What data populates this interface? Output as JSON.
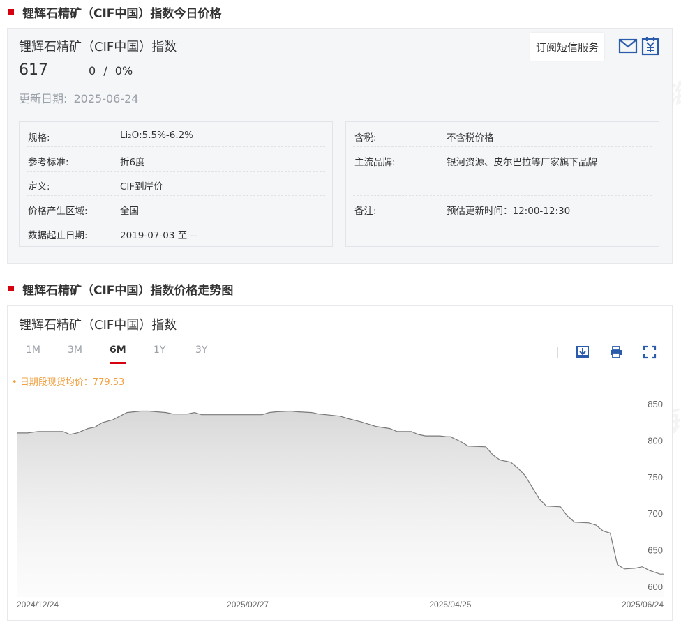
{
  "section1": {
    "title": "锂辉石精矿（CIF中国）指数今日价格"
  },
  "card1": {
    "name": "锂辉石精矿（CIF中国）指数",
    "price": "617",
    "change": "0",
    "separator": "/",
    "change_pct": "0%",
    "date_label": "更新日期:",
    "date_value": "2025-06-24",
    "sms_label": "订阅短信服务"
  },
  "spec_left": [
    {
      "k": "规格:",
      "v": "Li₂O:5.5%-6.2%"
    },
    {
      "k": "参考标准:",
      "v": "折6度"
    },
    {
      "k": "定义:",
      "v": "CIF到岸价"
    },
    {
      "k": "价格产生区域:",
      "v": "全国"
    },
    {
      "k": "数据起止日期:",
      "v": "2019-07-03 至 --"
    }
  ],
  "spec_right": [
    {
      "k": "含税:",
      "v": "不含税价格"
    },
    {
      "k": "主流品牌:",
      "v": "银河资源、皮尔巴拉等厂家旗下品牌"
    },
    {
      "k": "备注:",
      "v": "预估更新时间：12:00-12:30"
    }
  ],
  "section2": {
    "title": "锂辉石精矿（CIF中国）指数价格走势图"
  },
  "card2": {
    "name": "锂辉石精矿（CIF中国）指数",
    "tabs": [
      "1M",
      "3M",
      "6M",
      "1Y",
      "3Y"
    ],
    "active_tab": "6M",
    "avg_label": "• 日期段现货均价：779.53"
  },
  "watermark": {
    "text": "SMM 上海有色网"
  },
  "icons": {
    "mail": "mail-icon",
    "yuan": "yuan-calendar-icon",
    "download": "download-icon",
    "print": "print-icon",
    "fullscreen": "fullscreen-icon"
  },
  "colors": {
    "accent": "#d6000f",
    "icon_blue": "#2b5cab",
    "avg": "#f0a040",
    "line": "#7a7a7a"
  },
  "chart_data": {
    "type": "area",
    "title": "",
    "xlabel": "",
    "ylabel": "",
    "ylim": [
      600,
      870
    ],
    "yticks": [
      600,
      650,
      700,
      750,
      800,
      850
    ],
    "xticks": [
      {
        "label": "2024/12/24",
        "x": "2024-12-24"
      },
      {
        "label": "2025/02/27",
        "x": "2025-02-27"
      },
      {
        "label": "2025/04/25",
        "x": "2025-04-25"
      },
      {
        "label": "2025/06/24",
        "x": "2025-06-24"
      }
    ],
    "x_range": [
      "2024-12-24",
      "2025-06-24"
    ],
    "grid": false,
    "series": [
      {
        "points": [
          [
            "2024-12-24",
            810
          ],
          [
            "2024-12-27",
            810
          ],
          [
            "2024-12-30",
            812
          ],
          [
            "2025-01-02",
            812
          ],
          [
            "2025-01-06",
            812
          ],
          [
            "2025-01-08",
            808
          ],
          [
            "2025-01-10",
            810
          ],
          [
            "2025-01-13",
            816
          ],
          [
            "2025-01-15",
            818
          ],
          [
            "2025-01-17",
            824
          ],
          [
            "2025-01-20",
            828
          ],
          [
            "2025-01-22",
            833
          ],
          [
            "2025-01-24",
            838
          ],
          [
            "2025-01-28",
            840
          ],
          [
            "2025-01-30",
            840
          ],
          [
            "2025-02-04",
            838
          ],
          [
            "2025-02-06",
            836
          ],
          [
            "2025-02-10",
            836
          ],
          [
            "2025-02-12",
            838
          ],
          [
            "2025-02-14",
            835
          ],
          [
            "2025-02-18",
            835
          ],
          [
            "2025-02-21",
            835
          ],
          [
            "2025-02-25",
            835
          ],
          [
            "2025-02-27",
            835
          ],
          [
            "2025-03-03",
            835
          ],
          [
            "2025-03-05",
            838
          ],
          [
            "2025-03-07",
            839
          ],
          [
            "2025-03-11",
            840
          ],
          [
            "2025-03-13",
            839
          ],
          [
            "2025-03-17",
            838
          ],
          [
            "2025-03-19",
            836
          ],
          [
            "2025-03-21",
            835
          ],
          [
            "2025-03-25",
            833
          ],
          [
            "2025-03-27",
            830
          ],
          [
            "2025-03-31",
            825
          ],
          [
            "2025-04-02",
            822
          ],
          [
            "2025-04-04",
            819
          ],
          [
            "2025-04-08",
            816
          ],
          [
            "2025-04-10",
            812
          ],
          [
            "2025-04-14",
            812
          ],
          [
            "2025-04-16",
            808
          ],
          [
            "2025-04-18",
            806
          ],
          [
            "2025-04-22",
            806
          ],
          [
            "2025-04-24",
            805
          ],
          [
            "2025-04-25",
            805
          ],
          [
            "2025-04-28",
            798
          ],
          [
            "2025-04-30",
            792
          ],
          [
            "2025-05-05",
            791
          ],
          [
            "2025-05-07",
            780
          ],
          [
            "2025-05-09",
            773
          ],
          [
            "2025-05-12",
            770
          ],
          [
            "2025-05-14",
            762
          ],
          [
            "2025-05-16",
            752
          ],
          [
            "2025-05-20",
            720
          ],
          [
            "2025-05-22",
            710
          ],
          [
            "2025-05-26",
            709
          ],
          [
            "2025-05-28",
            696
          ],
          [
            "2025-05-30",
            688
          ],
          [
            "2025-06-03",
            687
          ],
          [
            "2025-06-05",
            684
          ],
          [
            "2025-06-07",
            676
          ],
          [
            "2025-06-09",
            673
          ],
          [
            "2025-06-11",
            630
          ],
          [
            "2025-06-13",
            624
          ],
          [
            "2025-06-16",
            625
          ],
          [
            "2025-06-18",
            627
          ],
          [
            "2025-06-20",
            622
          ],
          [
            "2025-06-23",
            617
          ],
          [
            "2025-06-24",
            617
          ]
        ]
      }
    ]
  }
}
